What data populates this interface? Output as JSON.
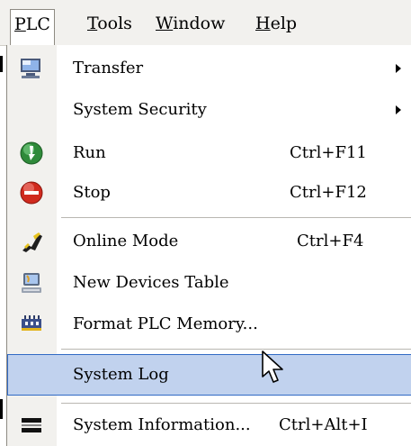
{
  "menubar": {
    "items": [
      {
        "label": "PLC",
        "accel": "P",
        "rest": "LC"
      },
      {
        "label": "Tools",
        "accel": "T",
        "rest": "ools"
      },
      {
        "label": "Window",
        "accel": "W",
        "rest": "indow"
      },
      {
        "label": "Help",
        "accel": "H",
        "rest": "elp"
      }
    ]
  },
  "menu": {
    "items": [
      {
        "label": "Transfer",
        "shortcut": "",
        "icon": "transfer-icon",
        "submenu": true
      },
      {
        "label": "System Security",
        "shortcut": "",
        "icon": "",
        "submenu": true
      },
      {
        "label": "Run",
        "shortcut": "Ctrl+F11",
        "icon": "run-icon"
      },
      {
        "label": "Stop",
        "shortcut": "Ctrl+F12",
        "icon": "stop-icon"
      },
      {
        "label": "Online Mode",
        "shortcut": "Ctrl+F4",
        "icon": "online-mode-icon"
      },
      {
        "label": "New Devices Table",
        "shortcut": "",
        "icon": "devices-table-icon"
      },
      {
        "label": "Format PLC Memory...",
        "shortcut": "",
        "icon": "format-memory-icon"
      },
      {
        "label": "System Log",
        "shortcut": "",
        "icon": "",
        "highlighted": true
      },
      {
        "label": "System Information...",
        "shortcut": "Ctrl+Alt+I",
        "icon": "system-info-icon"
      }
    ]
  },
  "colors": {
    "highlight_bg": "#c1d2ee",
    "highlight_border": "#316ac5",
    "gutter": "#f2f1ee"
  }
}
